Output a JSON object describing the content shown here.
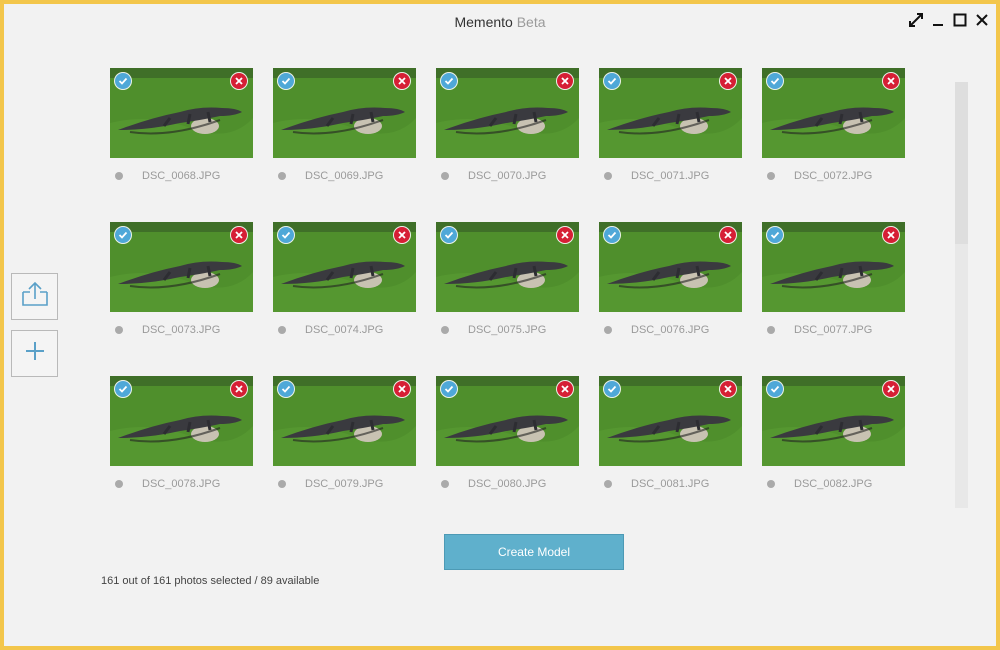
{
  "window": {
    "title_app": "Memento",
    "title_suffix": "Beta",
    "controls": [
      "expand-icon",
      "minimize-icon",
      "maximize-icon",
      "close-icon"
    ]
  },
  "left_toolbar": {
    "items": [
      "upload-icon",
      "add-icon"
    ]
  },
  "photos": [
    {
      "filename": "DSC_0068.JPG",
      "selected": true
    },
    {
      "filename": "DSC_0069.JPG",
      "selected": true
    },
    {
      "filename": "DSC_0070.JPG",
      "selected": true
    },
    {
      "filename": "DSC_0071.JPG",
      "selected": true
    },
    {
      "filename": "DSC_0072.JPG",
      "selected": true
    },
    {
      "filename": "DSC_0073.JPG",
      "selected": true
    },
    {
      "filename": "DSC_0074.JPG",
      "selected": true
    },
    {
      "filename": "DSC_0075.JPG",
      "selected": true
    },
    {
      "filename": "DSC_0076.JPG",
      "selected": true
    },
    {
      "filename": "DSC_0077.JPG",
      "selected": true
    },
    {
      "filename": "DSC_0078.JPG",
      "selected": true
    },
    {
      "filename": "DSC_0079.JPG",
      "selected": true
    },
    {
      "filename": "DSC_0080.JPG",
      "selected": true
    },
    {
      "filename": "DSC_0081.JPG",
      "selected": true
    },
    {
      "filename": "DSC_0082.JPG",
      "selected": true
    }
  ],
  "create_button_label": "Create Model",
  "status_text": "161 out of 161 photos selected / 89 available",
  "colors": {
    "window_border": "#f3c64b",
    "accent_button": "#5fb0cc",
    "check_badge": "#4fa8d8",
    "remove_badge": "#d61f35",
    "grass": "#4f8f2c"
  }
}
